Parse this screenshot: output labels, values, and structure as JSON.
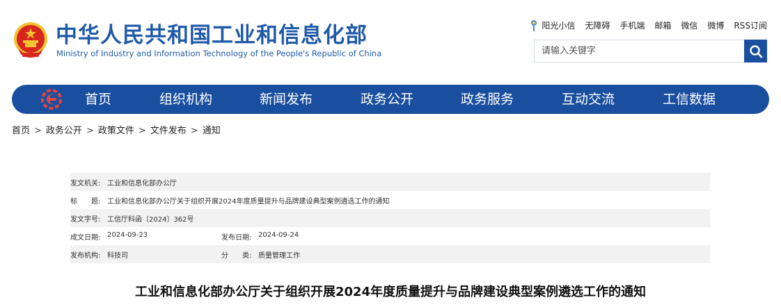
{
  "header": {
    "title_cn": "中华人民共和国工业和信息化部",
    "title_en": "Ministry of Industry and Information Technology of the People's Republic of China",
    "emblem_icon": "national-emblem-icon",
    "top_links": [
      "阳光小信",
      "无障碍",
      "手机端",
      "邮箱",
      "微信",
      "微博",
      "RSS订阅"
    ],
    "search_placeholder": "请输入关键字",
    "search_icon": "search-icon"
  },
  "nav": {
    "logo_icon": "miit-logo-icon",
    "items": [
      "首页",
      "组织机构",
      "新闻发布",
      "政务公开",
      "政务服务",
      "互动交流",
      "工信数据"
    ]
  },
  "breadcrumb": [
    "首页",
    "政务公开",
    "政策文件",
    "文件发布",
    "通知"
  ],
  "info": {
    "issuer_label": "发文机关:",
    "issuer": "工业和信息化部办公厅",
    "title_label": "标　　题:",
    "title": "工业和信息化部办公厅关于组织开展2024年度质量提升与品牌建设典型案例遴选工作的通知",
    "doc_no_label": "发文字号:",
    "doc_no": "工信厅科函〔2024〕362号",
    "date_label": "成文日期:",
    "date": "2024-09-23",
    "pub_date_label": "发布日期:",
    "pub_date": "2024-09-24",
    "org_label": "发布机构:",
    "org": "科技司",
    "category_label": "分　　类:",
    "category": "质量管理工作"
  },
  "document": {
    "title": "工业和信息化部办公厅关于组织开展2024年度质量提升与品牌建设典型案例遴选工作的通知"
  },
  "colors": {
    "brand_blue": "#1a4fa0",
    "title_blue": "#1f5aa8",
    "emblem_red": "#d7261e",
    "emblem_gold": "#f2c230"
  }
}
